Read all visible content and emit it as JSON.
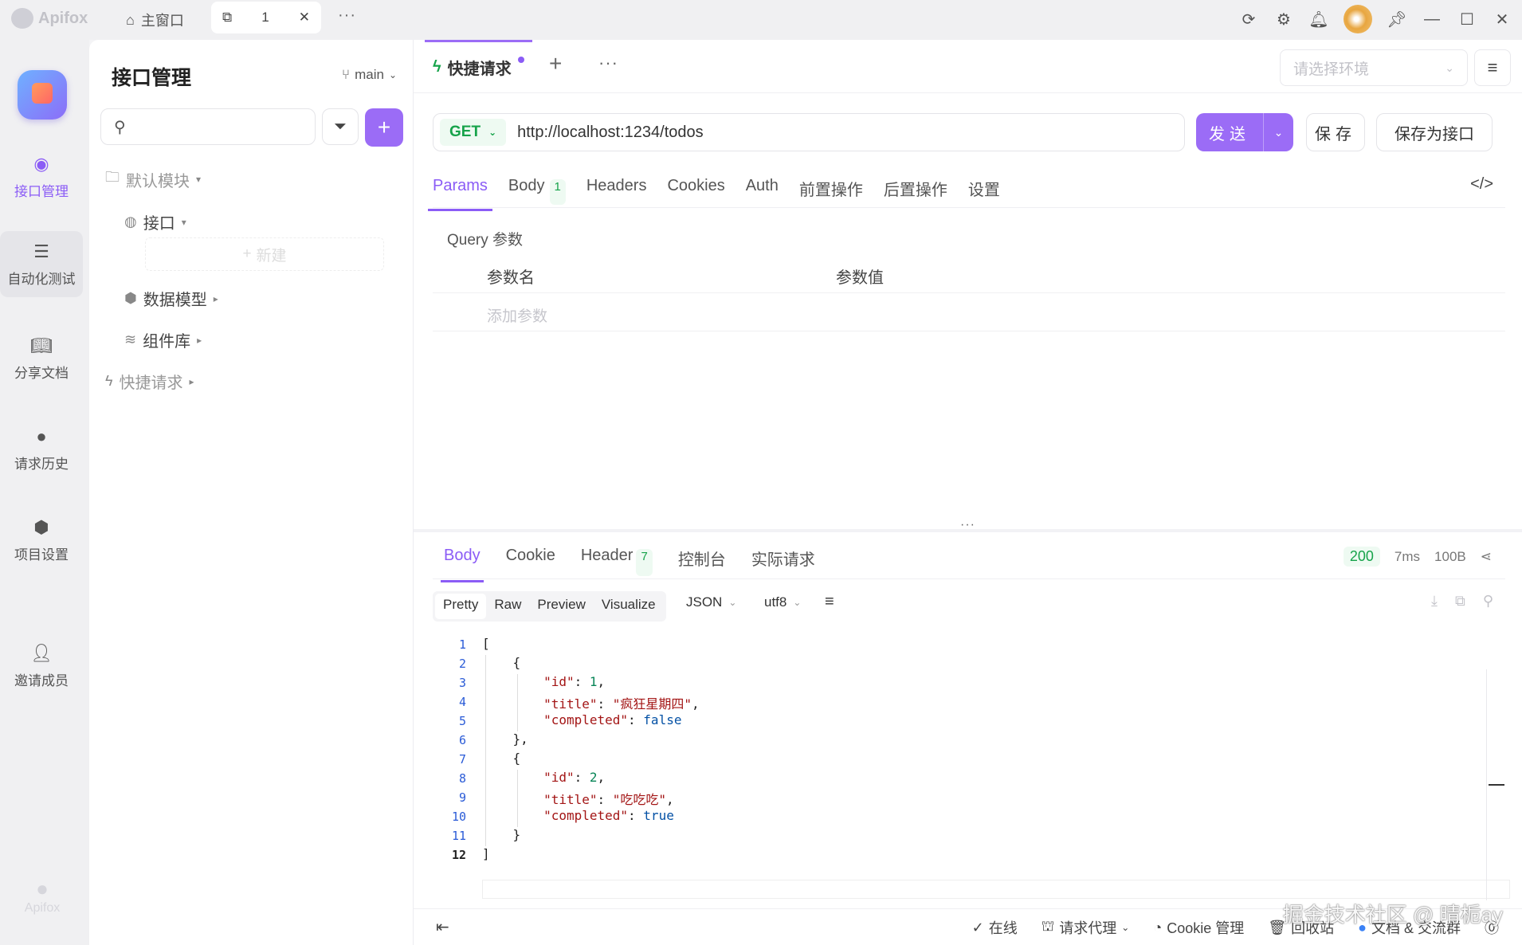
{
  "app": {
    "brand": "Apifox",
    "tabs": {
      "home": "主窗口",
      "active": "1"
    }
  },
  "rail": {
    "items": [
      {
        "label": "接口管理",
        "icon": "api-icon"
      },
      {
        "label": "自动化测试",
        "icon": "stack-icon"
      },
      {
        "label": "分享文档",
        "icon": "book-icon"
      },
      {
        "label": "请求历史",
        "icon": "clock-icon"
      },
      {
        "label": "项目设置",
        "icon": "settings-icon"
      },
      {
        "label": "邀请成员",
        "icon": "add-user-icon"
      }
    ],
    "footer_brand": "Apifox"
  },
  "sidebar": {
    "title": "接口管理",
    "branch": "main",
    "new_label": "新建",
    "tree": [
      {
        "label": "默认模块",
        "icon": "folder-icon"
      },
      {
        "label": "接口",
        "icon": "api-icon"
      },
      {
        "label": "数据模型",
        "icon": "cube-icon"
      },
      {
        "label": "组件库",
        "icon": "layers-icon"
      },
      {
        "label": "快捷请求",
        "icon": "lightning-icon"
      }
    ]
  },
  "request": {
    "tab_label": "快捷请求",
    "env_placeholder": "请选择环境",
    "method": "GET",
    "url": "http://localhost:1234/todos",
    "send": "发送",
    "save": "保存",
    "save_as": "保存为接口",
    "subtabs": [
      "Params",
      "Body",
      "Headers",
      "Cookies",
      "Auth",
      "前置操作",
      "后置操作",
      "设置"
    ],
    "body_count": "1",
    "query_title": "Query 参数",
    "col_name": "参数名",
    "col_value": "参数值",
    "add_param": "添加参数"
  },
  "response": {
    "tabs": [
      "Body",
      "Cookie",
      "Header",
      "控制台",
      "实际请求"
    ],
    "header_count": "7",
    "status": "200",
    "time": "7ms",
    "size": "100B",
    "views": [
      "Pretty",
      "Raw",
      "Preview",
      "Visualize"
    ],
    "format": "JSON",
    "encoding": "utf8",
    "lines": [
      "1",
      "2",
      "3",
      "4",
      "5",
      "6",
      "7",
      "8",
      "9",
      "10",
      "11",
      "12"
    ],
    "items": [
      {
        "id": "1",
        "title": "\"疯狂星期四\"",
        "completed": "false"
      },
      {
        "id": "2",
        "title": "\"吃吃吃\"",
        "completed": "true"
      }
    ],
    "keys": {
      "id": "\"id\"",
      "title": "\"title\"",
      "completed": "\"completed\""
    }
  },
  "statusbar": {
    "online": "在线",
    "proxy": "请求代理",
    "cookie": "Cookie 管理",
    "trash": "回收站",
    "docs": "文档 & 交流群"
  },
  "watermark": "掘金技术社区 @ 晴栀ay",
  "colors": {
    "accent": "#9b6cf6",
    "success": "#16a34a"
  }
}
